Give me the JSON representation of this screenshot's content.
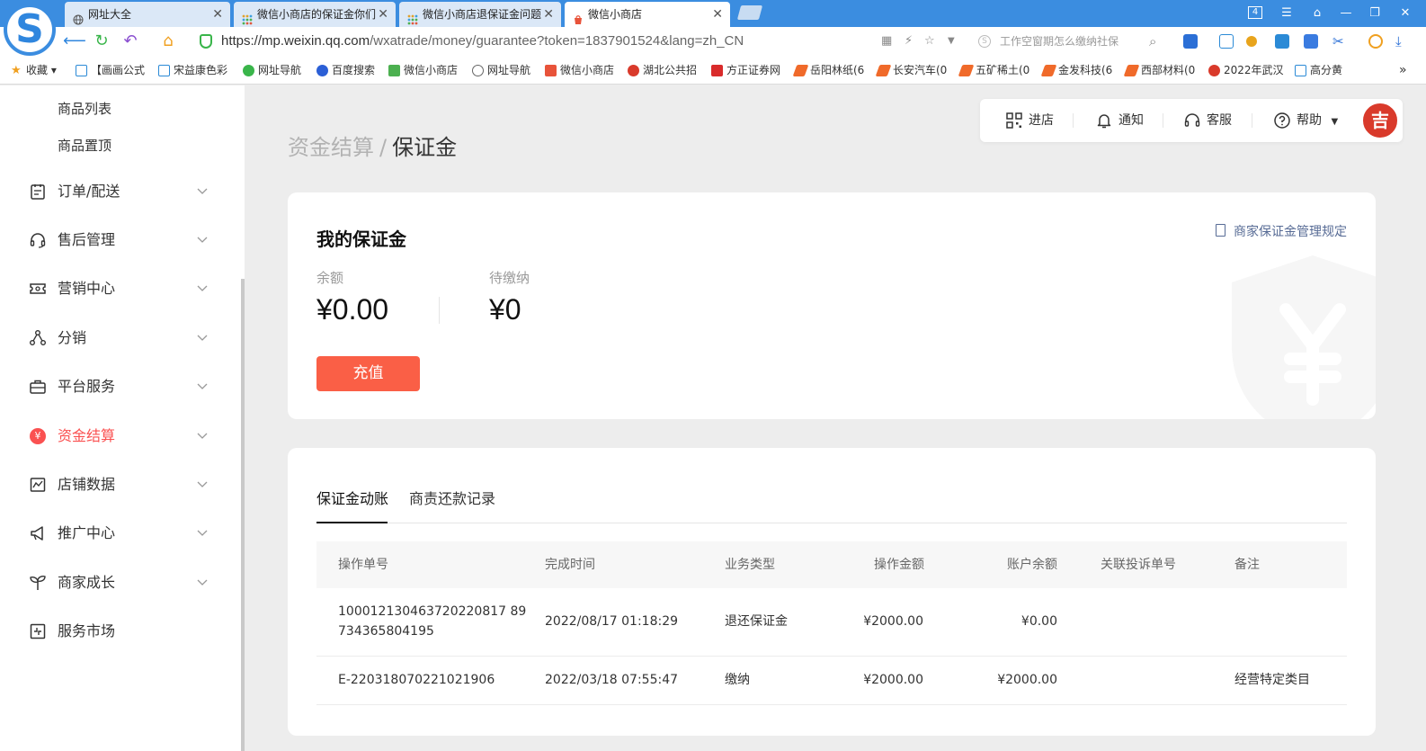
{
  "browser": {
    "tabs": [
      {
        "label": "网址大全",
        "active": false
      },
      {
        "label": "微信小商店的保证金你们",
        "active": false
      },
      {
        "label": "微信小商店退保证金问题",
        "active": false
      },
      {
        "label": "微信小商店",
        "active": true
      }
    ],
    "window_badge": "4",
    "url_host": "https://mp.weixin.qq.com",
    "url_path": "/wxatrade/money/guarantee?token=1837901524&lang=zh_CN",
    "search_hint": "工作空窗期怎么缴纳社保",
    "bookmarks": [
      "收藏",
      "【画画公式",
      "宋益康色彩",
      "网址导航",
      "百度搜索",
      "微信小商店",
      "网址导航",
      "微信小商店",
      "湖北公共招",
      "方正证券网",
      "岳阳林纸(6",
      "长安汽车(0",
      "五矿稀土(0",
      "金发科技(6",
      "西部材料(0",
      "2022年武汉",
      "高分黄"
    ]
  },
  "sidebar": {
    "sub_items": [
      "商品列表",
      "商品置顶"
    ],
    "menu": [
      {
        "label": "订单/配送",
        "icon": "clipboard-icon"
      },
      {
        "label": "售后管理",
        "icon": "headset-icon"
      },
      {
        "label": "营销中心",
        "icon": "ticket-icon"
      },
      {
        "label": "分销",
        "icon": "share-nodes-icon"
      },
      {
        "label": "平台服务",
        "icon": "briefcase-icon"
      },
      {
        "label": "资金结算",
        "icon": "yen-circle-icon",
        "active": true
      },
      {
        "label": "店铺数据",
        "icon": "chart-icon"
      },
      {
        "label": "推广中心",
        "icon": "megaphone-icon"
      },
      {
        "label": "商家成长",
        "icon": "sprout-icon"
      },
      {
        "label": "服务市场",
        "icon": "puzzle-icon"
      }
    ]
  },
  "header": {
    "breadcrumb_parent": "资金结算",
    "breadcrumb_sep": "/",
    "breadcrumb_current": "保证金",
    "actions": [
      "进店",
      "通知",
      "客服",
      "帮助"
    ],
    "avatar_text": "吉"
  },
  "deposit": {
    "title": "我的保证金",
    "rules_link": "商家保证金管理规定",
    "balance_label": "余额",
    "balance_value": "¥0.00",
    "pending_label": "待缴纳",
    "pending_value": "¥0",
    "recharge_label": "充值"
  },
  "records": {
    "tabs": [
      "保证金动账",
      "商责还款记录"
    ],
    "columns": [
      "操作单号",
      "完成时间",
      "业务类型",
      "操作金额",
      "账户余额",
      "关联投诉单号",
      "备注"
    ],
    "rows": [
      {
        "order_line1": "100012130463720220817 89",
        "order_line2": "734365804195",
        "time": "2022/08/17 01:18:29",
        "type": "退还保证金",
        "amount": "¥2000.00",
        "balance": "¥0.00",
        "complaint": "",
        "remark": ""
      },
      {
        "order_line1": "E-220318070221021906",
        "order_line2": "",
        "time": "2022/03/18 07:55:47",
        "type": "缴纳",
        "amount": "¥2000.00",
        "balance": "¥2000.00",
        "complaint": "",
        "remark": "经营特定类目"
      }
    ]
  },
  "colors": {
    "accent": "#fa5151",
    "button": "#fa5f46",
    "link": "#576b95",
    "chrome": "#3b8de0"
  }
}
